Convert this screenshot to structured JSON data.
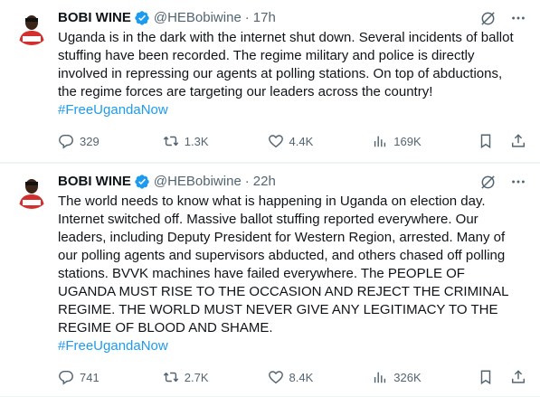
{
  "tweets": [
    {
      "author_name": "BOBI WINE",
      "handle": "@HEBobiwine",
      "separator": "·",
      "time": "17h",
      "text": "Uganda is in the dark with the internet shut down. Several incidents of ballot stuffing have been recorded. The regime military and police is directly involved in repressing our agents at polling stations. On top of abductions, the regime forces are targeting our leaders across the country!",
      "hashtag": "#FreeUgandaNow",
      "replies": "329",
      "retweets": "1.3K",
      "likes": "4.4K",
      "views": "169K"
    },
    {
      "author_name": "BOBI WINE",
      "handle": "@HEBobiwine",
      "separator": "·",
      "time": "22h",
      "text": "The world needs to know what is happening in Uganda on election day. Internet switched off. Massive ballot stuffing reported everywhere. Our leaders, including Deputy President for Western Region, arrested. Many of our polling agents and supervisors abducted, and others chased off polling stations. BVVK machines have failed everywhere. The PEOPLE OF UGANDA MUST RISE TO THE OCCASION AND REJECT THE CRIMINAL REGIME. THE WORLD MUST NEVER GIVE ANY LEGITIMACY TO THE REGIME OF BLOOD AND SHAME.",
      "hashtag": "#FreeUgandaNow",
      "replies": "741",
      "retweets": "2.7K",
      "likes": "8.4K",
      "views": "326K"
    }
  ],
  "colors": {
    "text": "#0f1419",
    "secondary": "#536471",
    "link": "#1d9bf0",
    "verified": "#1d9bf0",
    "avatar_red": "#d32f2f"
  },
  "icons": [
    "verified-badge-icon",
    "grok-icon",
    "more-icon",
    "reply-icon",
    "retweet-icon",
    "like-icon",
    "views-icon",
    "bookmark-icon",
    "share-icon"
  ]
}
